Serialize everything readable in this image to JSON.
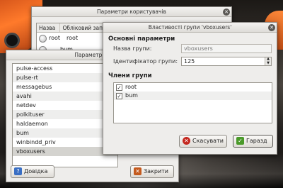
{
  "users_window": {
    "title": "Параметри користувачів",
    "columns": [
      "Назва",
      "Обліковий зап"
    ],
    "rows": [
      {
        "name": "root",
        "login": "root"
      },
      {
        "name": "",
        "login": "bum"
      }
    ]
  },
  "groups_window": {
    "title": "Параметри г",
    "groups": [
      "pulse-access",
      "pulse-rt",
      "messagebus",
      "avahi",
      "netdev",
      "polkituser",
      "haldaemon",
      "bum",
      "winbindd_priv",
      "vboxusers"
    ],
    "selected_group": "vboxusers",
    "help_button": "Довідка",
    "close_button": "Закрити"
  },
  "props_window": {
    "title": "Властивості групи 'vboxusers'",
    "main_section": "Основні параметри",
    "group_name_label": "Назва групи:",
    "group_name_value": "vboxusers",
    "group_id_label": "Ідентифікатор групи:",
    "group_id_value": "125",
    "members_section": "Члени групи",
    "members": [
      {
        "name": "root",
        "checked": true
      },
      {
        "name": "bum",
        "checked": true
      }
    ],
    "cancel_button": "Скасувати",
    "ok_button": "Гаразд"
  }
}
